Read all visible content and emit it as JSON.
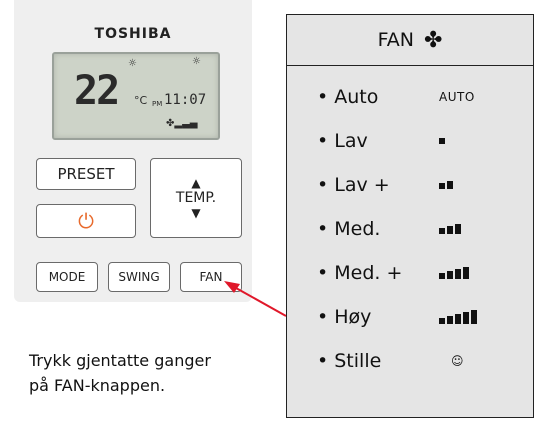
{
  "remote": {
    "brand": "TOSHIBA",
    "lcd": {
      "temp": "22",
      "unit": "°C",
      "pm": "PM",
      "clock": "11:07",
      "fan_indicator": "fan-icon with bars",
      "top_left_icon": "sun-icon",
      "top_right_icon": "sun-moon-icon"
    },
    "buttons": {
      "preset": "PRESET",
      "temp": "TEMP.",
      "power_icon": "power-icon",
      "mode": "MODE",
      "swing": "SWING",
      "fan": "FAN"
    }
  },
  "caption": {
    "line1": "Trykk gjentatte ganger",
    "line2": "på FAN-knappen."
  },
  "panel": {
    "title": "FAN",
    "title_icon": "fan-icon",
    "items": [
      {
        "label": "Auto",
        "indicator": "AUTO",
        "bars": 0
      },
      {
        "label": "Lav",
        "indicator": "",
        "bars": 1
      },
      {
        "label": "Lav +",
        "indicator": "",
        "bars": 2
      },
      {
        "label": "Med.",
        "indicator": "",
        "bars": 3
      },
      {
        "label": "Med. +",
        "indicator": "",
        "bars": 4
      },
      {
        "label": "Høy",
        "indicator": "",
        "bars": 5
      },
      {
        "label": "Stille",
        "indicator": "quiet-icon",
        "bars": 0
      }
    ]
  },
  "colors": {
    "power_icon": "#e86a2c",
    "arrow": "#e0182a",
    "panel_bg": "#e5e5e5"
  }
}
